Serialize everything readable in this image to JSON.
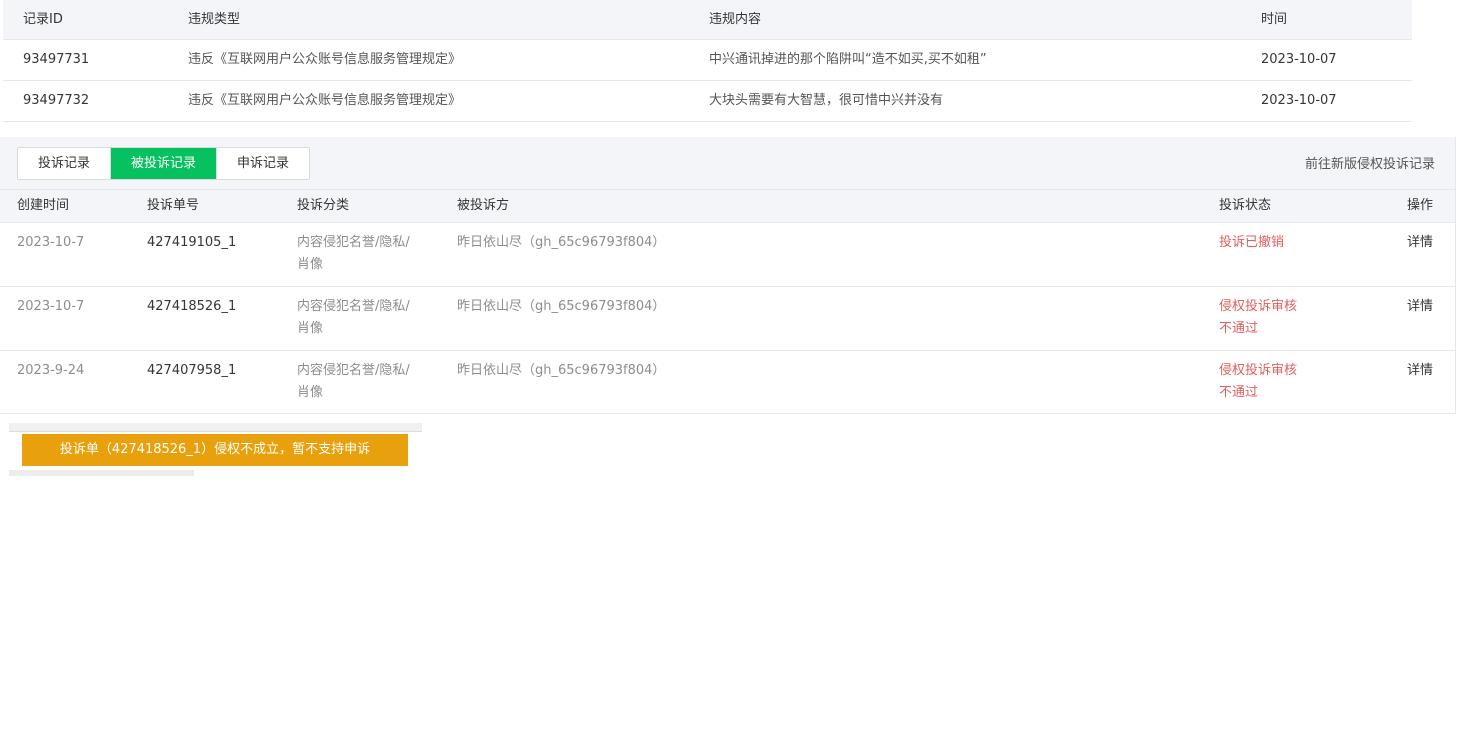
{
  "violations": {
    "headers": {
      "id": "记录ID",
      "type": "违规类型",
      "content": "违规内容",
      "time": "时间"
    },
    "rows": [
      {
        "id": "93497731",
        "type": "违反《互联网用户公众账号信息服务管理规定》",
        "content": "中兴通讯掉进的那个陷阱叫“造不如买,买不如租”",
        "time": "2023-10-07"
      },
      {
        "id": "93497732",
        "type": "违反《互联网用户公众账号信息服务管理规定》",
        "content": "大块头需要有大智慧，很可惜中兴并没有",
        "time": "2023-10-07"
      }
    ]
  },
  "complaints": {
    "tabs": [
      {
        "label": "投诉记录",
        "active": false
      },
      {
        "label": "被投诉记录",
        "active": true
      },
      {
        "label": "申诉记录",
        "active": false
      }
    ],
    "new_version_link": "前往新版侵权投诉记录",
    "headers": {
      "date": "创建时间",
      "no": "投诉单号",
      "category": "投诉分类",
      "party": "被投诉方",
      "status": "投诉状态",
      "op": "操作"
    },
    "rows": [
      {
        "date": "2023-10-7",
        "no": "427419105_1",
        "category": "内容侵犯名誉/隐私/肖像",
        "party": "昨日依山尽（gh_65c96793f804）",
        "status": "投诉已撤销",
        "op": "详情"
      },
      {
        "date": "2023-10-7",
        "no": "427418526_1",
        "category": "内容侵犯名誉/隐私/肖像",
        "party": "昨日依山尽（gh_65c96793f804）",
        "status": "侵权投诉审核不通过",
        "op": "详情"
      },
      {
        "date": "2023-9-24",
        "no": "427407958_1",
        "category": "内容侵犯名誉/隐私/肖像",
        "party": "昨日依山尽（gh_65c96793f804）",
        "status": "侵权投诉审核不通过",
        "op": "详情"
      }
    ]
  },
  "toast": {
    "message": "投诉单（427418526_1）侵权不成立，暂不支持申诉"
  },
  "colors": {
    "active_tab": "#07c160",
    "status_text": "#e15f5f",
    "toast_bg": "#e8a10c"
  }
}
